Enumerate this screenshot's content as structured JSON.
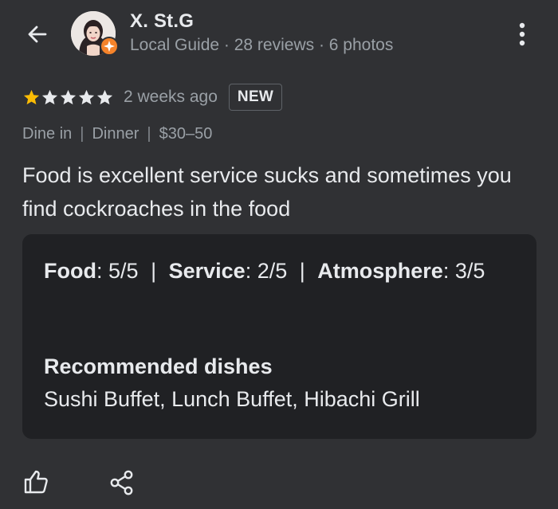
{
  "header": {
    "back_icon": "arrow-back-icon",
    "more_icon": "more-vert-icon",
    "user": {
      "name": "X. St.G",
      "meta": "Local Guide · 28 reviews · 6 photos",
      "badge_icon": "local-guide-badge-icon",
      "badge_color": "#f5832a"
    }
  },
  "review": {
    "rating": 5,
    "max_rating": 5,
    "filled_star_color": "#fbbc04",
    "empty_star_color": "#e8eaed",
    "time_ago": "2 weeks ago",
    "new_badge": "NEW",
    "tags": [
      "Dine in",
      "Dinner",
      "$30–50"
    ],
    "text": "Food is excellent service sucks and sometimes you find cockroaches in the food"
  },
  "details": {
    "ratings": [
      {
        "label": "Food",
        "value": "5/5"
      },
      {
        "label": "Service",
        "value": "2/5"
      },
      {
        "label": "Atmosphere",
        "value": "3/5"
      }
    ],
    "dishes_label": "Recommended dishes",
    "dishes_value": "Sushi Buffet, Lunch Buffet, Hibachi Grill"
  },
  "actions": {
    "like_icon": "thumbs-up-icon",
    "share_icon": "share-icon"
  },
  "colors": {
    "background": "#303134",
    "card": "#202124",
    "text_primary": "#e8eaed",
    "text_secondary": "#9aa0a6"
  }
}
